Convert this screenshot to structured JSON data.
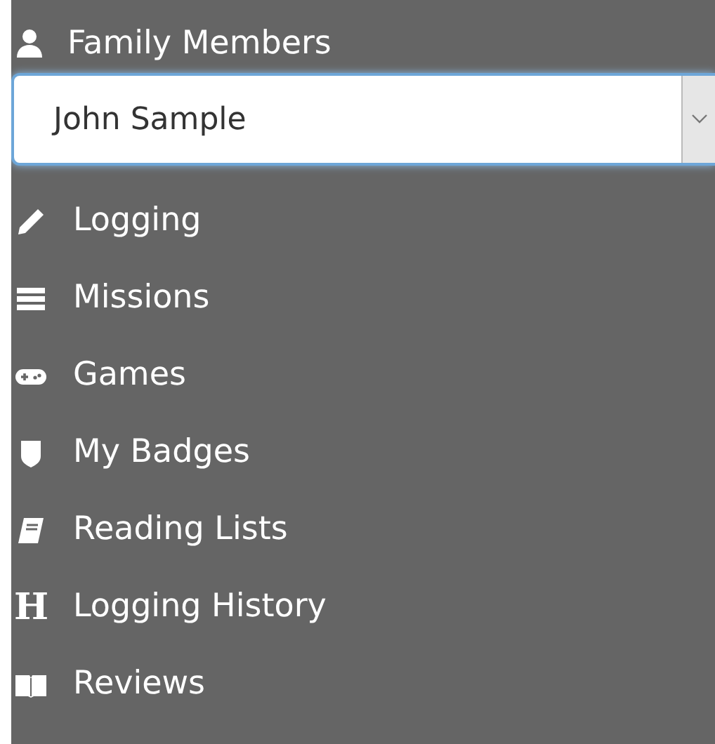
{
  "header": {
    "label": "Family Members"
  },
  "member_select": {
    "value": "John Sample"
  },
  "menu": [
    {
      "kind": "pencil",
      "label": "Logging"
    },
    {
      "kind": "list",
      "label": "Missions"
    },
    {
      "kind": "gamepad",
      "label": "Games"
    },
    {
      "kind": "shield",
      "label": "My Badges"
    },
    {
      "kind": "book",
      "label": "Reading Lists"
    },
    {
      "kind": "letter",
      "glyph": "H",
      "label": "Logging History"
    },
    {
      "kind": "open-book",
      "label": "Reviews"
    }
  ]
}
